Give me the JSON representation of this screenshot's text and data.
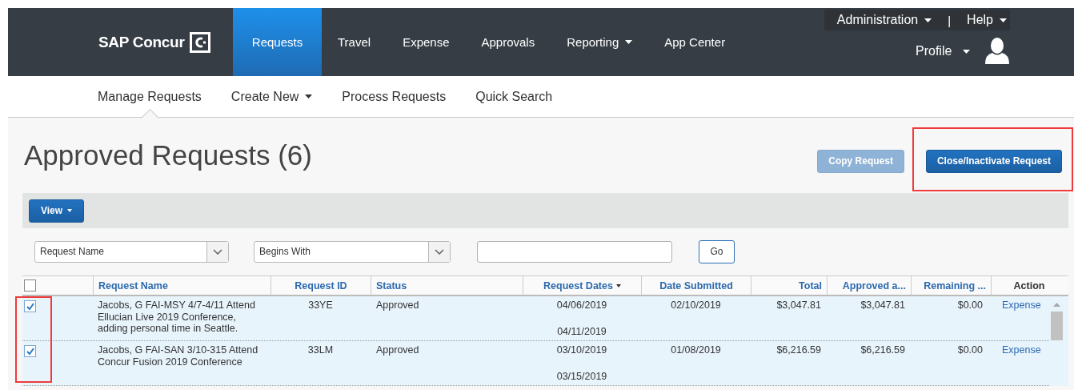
{
  "nav": {
    "logo": "SAP Concur",
    "tabs": [
      {
        "label": "Requests",
        "selected": true,
        "dropdown": false
      },
      {
        "label": "Travel",
        "selected": false,
        "dropdown": false
      },
      {
        "label": "Expense",
        "selected": false,
        "dropdown": false
      },
      {
        "label": "Approvals",
        "selected": false,
        "dropdown": false
      },
      {
        "label": "Reporting",
        "selected": false,
        "dropdown": true
      },
      {
        "label": "App Center",
        "selected": false,
        "dropdown": false
      }
    ],
    "utility": [
      {
        "label": "Administration",
        "dropdown": true
      },
      {
        "label": "Help",
        "dropdown": true
      }
    ],
    "separator": "|",
    "profile": {
      "label": "Profile",
      "dropdown": true
    }
  },
  "subnav": [
    {
      "label": "Manage Requests",
      "selected": true,
      "dropdown": false
    },
    {
      "label": "Create New",
      "selected": false,
      "dropdown": true
    },
    {
      "label": "Process Requests",
      "selected": false,
      "dropdown": false
    },
    {
      "label": "Quick Search",
      "selected": false,
      "dropdown": false
    }
  ],
  "title": "Approved Requests (6)",
  "buttons": [
    {
      "label": "Copy Request",
      "disabled": true,
      "highlighted": false
    },
    {
      "label": "Close/Inactivate Request",
      "disabled": false,
      "highlighted": true
    }
  ],
  "view_button": "View",
  "filters": {
    "field": "Request Name",
    "operator": "Begins With",
    "go_button": "Go"
  },
  "table": {
    "select_all_checked": false,
    "select_column_highlighted": true,
    "columns": [
      {
        "label": "Request Name",
        "kind": "link",
        "sorted": false
      },
      {
        "label": "Request ID",
        "kind": "link",
        "sorted": false
      },
      {
        "label": "Status",
        "kind": "link",
        "sorted": false
      },
      {
        "label": "Request Dates",
        "kind": "link",
        "sorted": true
      },
      {
        "label": "Date Submitted",
        "kind": "link",
        "sorted": false
      },
      {
        "label": "Total",
        "kind": "link",
        "sorted": false
      },
      {
        "label": "Approved a...",
        "kind": "link",
        "sorted": false
      },
      {
        "label": "Remaining ...",
        "kind": "link",
        "sorted": false
      },
      {
        "label": "Action",
        "kind": "plain",
        "sorted": false
      }
    ],
    "rows": [
      {
        "checked": true,
        "name": "Jacobs, G FAI-MSY 4/7-4/11 Attend Ellucian Live 2019 Conference, adding personal time in Seattle.",
        "id": "33YE",
        "status": "Approved",
        "dates": [
          "04/06/2019",
          "04/11/2019"
        ],
        "submitted": "02/10/2019",
        "total": "$3,047.81",
        "approved": "$3,047.81",
        "remaining": "$0.00",
        "action": "Expense"
      },
      {
        "checked": true,
        "name": "Jacobs, G FAI-SAN 3/10-315 Attend Concur Fusion 2019 Conference",
        "id": "33LM",
        "status": "Approved",
        "dates": [
          "03/10/2019",
          "03/15/2019"
        ],
        "submitted": "01/08/2019",
        "total": "$6,216.59",
        "approved": "$6,216.59",
        "remaining": "$0.00",
        "action": "Expense"
      }
    ]
  }
}
